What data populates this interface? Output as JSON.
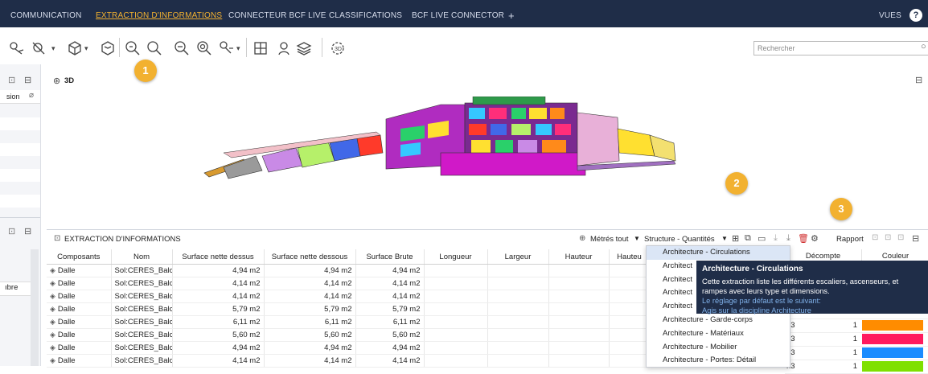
{
  "nav": {
    "tabs": [
      {
        "label": "COMMUNICATION",
        "active": false
      },
      {
        "label": "EXTRACTION D'INFORMATIONS",
        "active": true
      },
      {
        "label": "CONNECTEUR BCF LIVE",
        "active": false
      },
      {
        "label": "CLASSIFICATIONS",
        "active": false
      },
      {
        "label": "BCF LIVE CONNECTOR",
        "active": false
      }
    ],
    "add_tab": "+",
    "views_label": "VUES",
    "help_label": "?"
  },
  "search": {
    "placeholder": "Rechercher"
  },
  "badges": [
    "1",
    "2",
    "3"
  ],
  "left_panel": {
    "tab_fragment": "sion",
    "row_fragment": "ıbre"
  },
  "view3d": {
    "title": "3D"
  },
  "extraction": {
    "title": "EXTRACTION D'INFORMATIONS",
    "metres_tout": "Métrés tout",
    "structure_select": "Structure - Quantités",
    "rapport": "Rapport",
    "columns": [
      "Composants",
      "Nom",
      "Surface nette dessus",
      "Surface nette dessous",
      "Surface Brute",
      "Longueur",
      "Largeur",
      "Hauteur",
      "Hauteu"
    ],
    "right_columns": [
      "Décompte",
      "Couleur"
    ],
    "rows": [
      {
        "comp": "Dalle",
        "nom": "Sol:CERES_Balc...",
        "snd": "4,94 m2",
        "snds": "4,94 m2",
        "sb": "4,94 m2",
        "unit": "",
        "count": "",
        "color": ""
      },
      {
        "comp": "Dalle",
        "nom": "Sol:CERES_Balc...",
        "snd": "4,14 m2",
        "snds": "4,14 m2",
        "sb": "4,14 m2",
        "unit": "",
        "count": "",
        "color": ""
      },
      {
        "comp": "Dalle",
        "nom": "Sol:CERES_Balc...",
        "snd": "4,14 m2",
        "snds": "4,14 m2",
        "sb": "4,14 m2",
        "unit": "",
        "count": "",
        "color": ""
      },
      {
        "comp": "Dalle",
        "nom": "Sol:CERES_Balc...",
        "snd": "5,79 m2",
        "snds": "5,79 m2",
        "sb": "5,79 m2",
        "unit": "",
        "count": "",
        "color": ""
      },
      {
        "comp": "Dalle",
        "nom": "Sol:CERES_Balc...",
        "snd": "6,11 m2",
        "snds": "6,11 m2",
        "sb": "6,11 m2",
        "unit": "n3",
        "count": "1",
        "color": "#ff8c00"
      },
      {
        "comp": "Dalle",
        "nom": "Sol:CERES_Balc...",
        "snd": "5,60 m2",
        "snds": "5,60 m2",
        "sb": "5,60 m2",
        "unit": "n3",
        "count": "1",
        "color": "#ff1a5e"
      },
      {
        "comp": "Dalle",
        "nom": "Sol:CERES_Balc...",
        "snd": "4,94 m2",
        "snds": "4,94 m2",
        "sb": "4,94 m2",
        "unit": "n3",
        "count": "1",
        "color": "#1a8cff"
      },
      {
        "comp": "Dalle",
        "nom": "Sol:CERES_Balc...",
        "snd": "4,14 m2",
        "snds": "4,14 m2",
        "sb": "4,14 m2",
        "unit": "n3",
        "count": "1",
        "color": "#7fe000"
      }
    ]
  },
  "dropdown": {
    "items": [
      {
        "label": "Architecture - Circulations",
        "selected": true
      },
      {
        "label": "Architect",
        "selected": false
      },
      {
        "label": "Architect",
        "selected": false
      },
      {
        "label": "Architect",
        "selected": false
      },
      {
        "label": "Architect",
        "selected": false
      },
      {
        "label": "Architecture - Garde-corps",
        "selected": false
      },
      {
        "label": "Architecture - Matériaux",
        "selected": false
      },
      {
        "label": "Architecture - Mobilier",
        "selected": false
      },
      {
        "label": "Architecture - Portes: Détail",
        "selected": false
      }
    ]
  },
  "tooltip": {
    "title": "Architecture - Circulations",
    "body": "Cette extraction liste les différents escaliers, ascenseurs, et rampes avec leurs type et dimensions.",
    "link1": "Le réglage par défaut est le suivant:",
    "link2": "Agis sur la discipline Architecture"
  },
  "colors": {
    "nav_bg": "#1f2d48",
    "accent": "#f2b130",
    "selection": "#dbe6f6"
  }
}
